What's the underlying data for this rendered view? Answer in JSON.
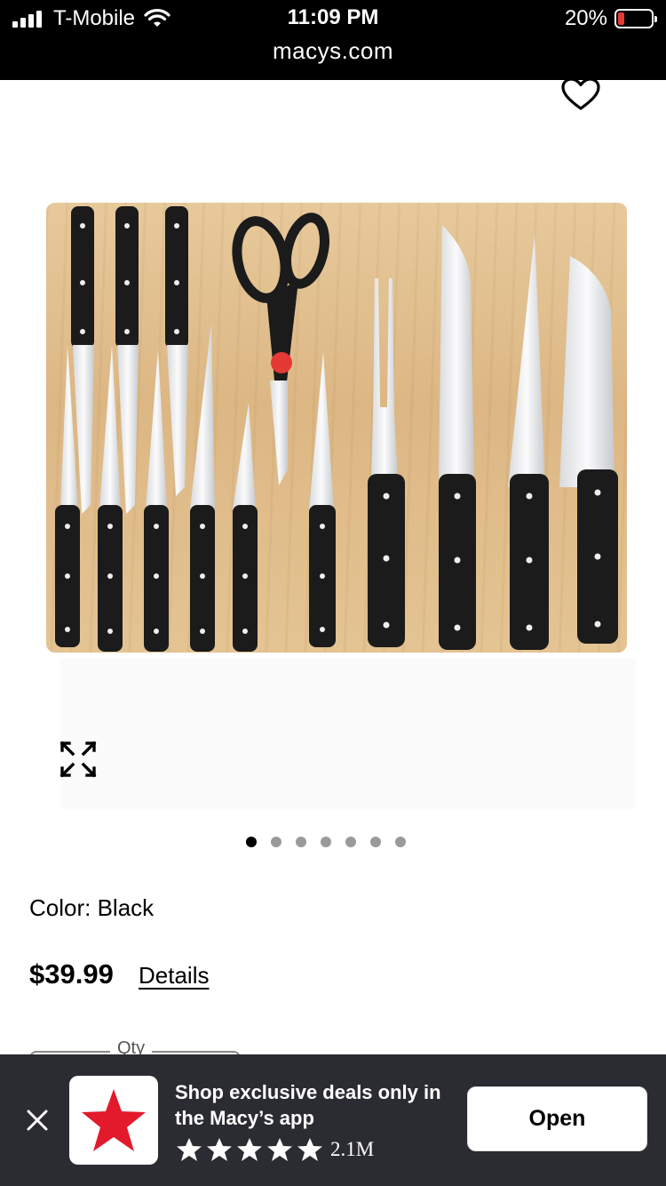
{
  "status_bar": {
    "carrier": "T-Mobile",
    "time": "11:09 PM",
    "battery": "20%",
    "battery_level": 0.2,
    "url": "macys.com"
  },
  "icons": {
    "favorite": "heart-icon",
    "expand": "expand-icon",
    "close": "close-icon",
    "logo": "macys-star-logo",
    "star": "star-icon"
  },
  "gallery": {
    "total_images": 7,
    "active_index": 0
  },
  "product": {
    "color_label": "Color: Black",
    "price": "$39.99",
    "details_link": "Details",
    "qty_label": "Qty"
  },
  "app_banner": {
    "message": "Shop exclusive deals only in the Macy’s app",
    "rating_stars": 5,
    "rating_count": "2.1M",
    "open_label": "Open",
    "logo_color": "#e21a2c"
  }
}
